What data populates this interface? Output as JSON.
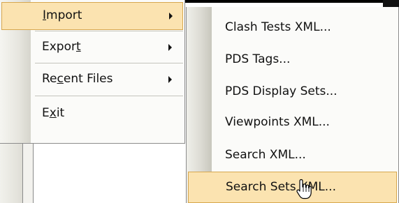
{
  "file_menu": {
    "items": [
      {
        "prefix": "",
        "accel": "I",
        "suffix": "mport",
        "has_submenu": true
      },
      {
        "prefix": "Expor",
        "accel": "t",
        "suffix": "",
        "has_submenu": true
      },
      {
        "prefix": "Re",
        "accel": "c",
        "suffix": "ent Files",
        "has_submenu": true
      },
      {
        "prefix": "E",
        "accel": "x",
        "suffix": "it",
        "has_submenu": false
      }
    ]
  },
  "import_submenu": {
    "items": [
      {
        "label": "Clash Tests XML..."
      },
      {
        "label": "PDS Tags..."
      },
      {
        "label": "PDS Display Sets..."
      },
      {
        "label": "Viewpoints XML..."
      },
      {
        "label": "Search XML..."
      },
      {
        "label": "Search Sets XML..."
      }
    ],
    "highlighted_index": 5
  },
  "colors": {
    "highlight_fill": "#fbe3b0",
    "highlight_border": "#d7a74e",
    "menu_background": "#fbfbf9"
  },
  "icons": {
    "submenu_arrow": "triangle-right",
    "cursor": "hand-pointer"
  }
}
